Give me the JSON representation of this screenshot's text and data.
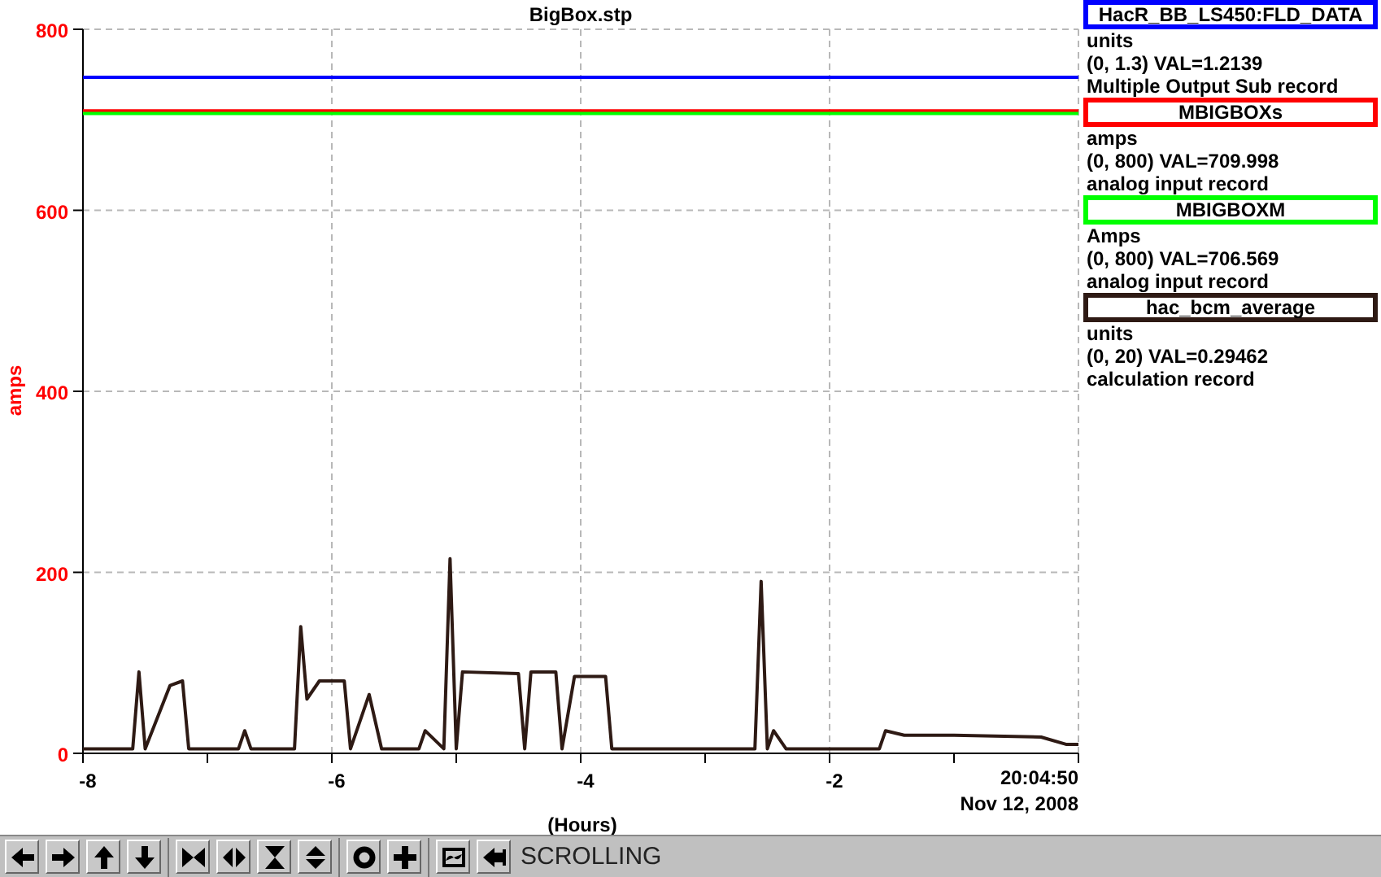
{
  "chart": {
    "chart_data": {
      "type": "line",
      "grid": true,
      "title": "BigBox.stp",
      "xlabel": "(Hours)",
      "ylabel": "amps",
      "xlim": [
        -8,
        0
      ],
      "ylim": [
        0,
        800
      ],
      "xticks": [
        -8,
        -6,
        -4,
        -2
      ],
      "yticks": [
        0,
        200,
        400,
        600,
        800
      ],
      "x": [
        -8,
        -7.6,
        -7.55,
        -7.5,
        -7.3,
        -7.2,
        -7.15,
        -6.75,
        -6.7,
        -6.65,
        -6.3,
        -6.25,
        -6.2,
        -6.1,
        -5.9,
        -5.85,
        -5.7,
        -5.6,
        -5.3,
        -5.25,
        -5.1,
        -5.05,
        -5,
        -4.95,
        -4.5,
        -4.45,
        -4.4,
        -4.2,
        -4.15,
        -4.05,
        -3.8,
        -3.75,
        -2.6,
        -2.55,
        -2.5,
        -2.45,
        -2.35,
        -1.6,
        -1.55,
        -1.4,
        -1,
        -0.3,
        -0.1,
        0
      ],
      "series": [
        {
          "name": "HacR_BB_LS450:FLD_DATA",
          "color": "#0000ff",
          "values": [
            747,
            747,
            747,
            747,
            747,
            747,
            747,
            747,
            747,
            747,
            747,
            747,
            747,
            747,
            747,
            747,
            747,
            747,
            747,
            747,
            747,
            747,
            747,
            747,
            747,
            747,
            747,
            747,
            747,
            747,
            747,
            747,
            747,
            747,
            747,
            747,
            747,
            747,
            747,
            747,
            747,
            747,
            747,
            747
          ]
        },
        {
          "name": "MBIGBOXs",
          "color": "#ff0000",
          "values": [
            710,
            710,
            710,
            710,
            710,
            710,
            710,
            710,
            710,
            710,
            710,
            710,
            710,
            710,
            710,
            710,
            710,
            710,
            710,
            710,
            710,
            710,
            710,
            710,
            710,
            710,
            710,
            710,
            710,
            710,
            710,
            710,
            710,
            710,
            710,
            710,
            710,
            710,
            710,
            710,
            710,
            710,
            710,
            710
          ]
        },
        {
          "name": "MBIGBOXM",
          "color": "#00ff00",
          "values": [
            707,
            707,
            707,
            707,
            707,
            707,
            707,
            707,
            707,
            707,
            707,
            707,
            707,
            707,
            707,
            707,
            707,
            707,
            707,
            707,
            707,
            707,
            707,
            707,
            707,
            707,
            707,
            707,
            707,
            707,
            707,
            707,
            707,
            707,
            707,
            707,
            707,
            707,
            707,
            707,
            707,
            707,
            707,
            707
          ]
        },
        {
          "name": "hac_bcm_average",
          "color": "#2e1a14",
          "values": [
            5,
            5,
            90,
            5,
            75,
            80,
            5,
            5,
            25,
            5,
            5,
            140,
            60,
            80,
            80,
            5,
            65,
            5,
            5,
            25,
            5,
            215,
            5,
            90,
            88,
            5,
            90,
            90,
            5,
            85,
            85,
            5,
            5,
            190,
            5,
            25,
            5,
            5,
            25,
            20,
            20,
            18,
            10,
            10
          ]
        }
      ]
    },
    "time": "20:04:50",
    "date": "Nov 12, 2008"
  },
  "legend": [
    {
      "units": "units",
      "range_value": "(0, 1.3) VAL=1.2139",
      "record_type": "Multiple Output Sub record"
    },
    {
      "units": "amps",
      "range_value": "(0, 800) VAL=709.998",
      "record_type": "analog input record"
    },
    {
      "units": "Amps",
      "range_value": "(0, 800) VAL=706.569",
      "record_type": "analog input record"
    },
    {
      "units": "units",
      "range_value": "(0, 20) VAL=0.29462",
      "record_type": "calculation record"
    }
  ],
  "toolbar": {
    "status": "SCROLLING"
  }
}
